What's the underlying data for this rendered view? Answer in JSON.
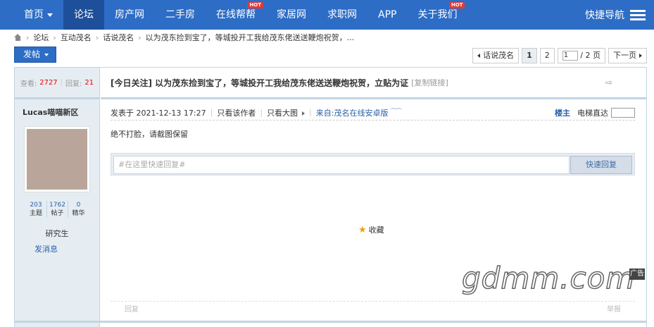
{
  "nav": {
    "items": [
      {
        "label": "首页",
        "dropdown": true,
        "active": false,
        "hot": false
      },
      {
        "label": "论坛",
        "active": true,
        "hot": false
      },
      {
        "label": "房产网",
        "active": false,
        "hot": false
      },
      {
        "label": "二手房",
        "active": false,
        "hot": false
      },
      {
        "label": "在线帮帮",
        "active": false,
        "hot": true
      },
      {
        "label": "家居网",
        "active": false,
        "hot": false
      },
      {
        "label": "求职网",
        "active": false,
        "hot": false
      },
      {
        "label": "APP",
        "active": false,
        "hot": false
      },
      {
        "label": "关于我们",
        "active": false,
        "hot": true
      }
    ],
    "hot_label": "HOT",
    "quick_nav": "快捷导航"
  },
  "breadcrumb": {
    "items": [
      "论坛",
      "互动茂名",
      "话说茂名",
      "以为茂东捡到宝了，等城投开工我给茂东佬送送鞭炮祝贺，..."
    ]
  },
  "post_button": "发帖",
  "pager": {
    "back": "话说茂名",
    "pages": [
      "1",
      "2"
    ],
    "current": "1",
    "input_value": "1",
    "total": "/ 2 页",
    "next": "下一页"
  },
  "thread": {
    "views_label": "查看:",
    "views": "2727",
    "replies_label": "回复:",
    "replies": "21",
    "title": "[今日关注] 以为茂东捡到宝了，等城投开工我给茂东佬送送鞭炮祝贺，立贴为证",
    "copy_link": "[复制链接]"
  },
  "author": {
    "name": "Lucas喵喵新区",
    "stats": [
      {
        "num": "203",
        "label": "主题"
      },
      {
        "num": "1762",
        "label": "帖子"
      },
      {
        "num": "0",
        "label": "精华"
      }
    ],
    "rank": "研究生",
    "message": "发消息"
  },
  "post": {
    "posted_at": "发表于 2021-12-13 17:27",
    "only_author": "只看该作者",
    "only_large_image": "只看大图",
    "from": "来自:茂名在线安卓版",
    "floor": "楼主",
    "floor_jump": "电梯直达",
    "content": "绝不打脸，请截图保留"
  },
  "quick_reply": {
    "placeholder": "#在这里快速回复#",
    "button": "快速回复"
  },
  "favorite": "收藏",
  "footer_links": {
    "reply": "回复",
    "report": "举报"
  },
  "watermark": "gdmm.com",
  "ad_label": "广告"
}
